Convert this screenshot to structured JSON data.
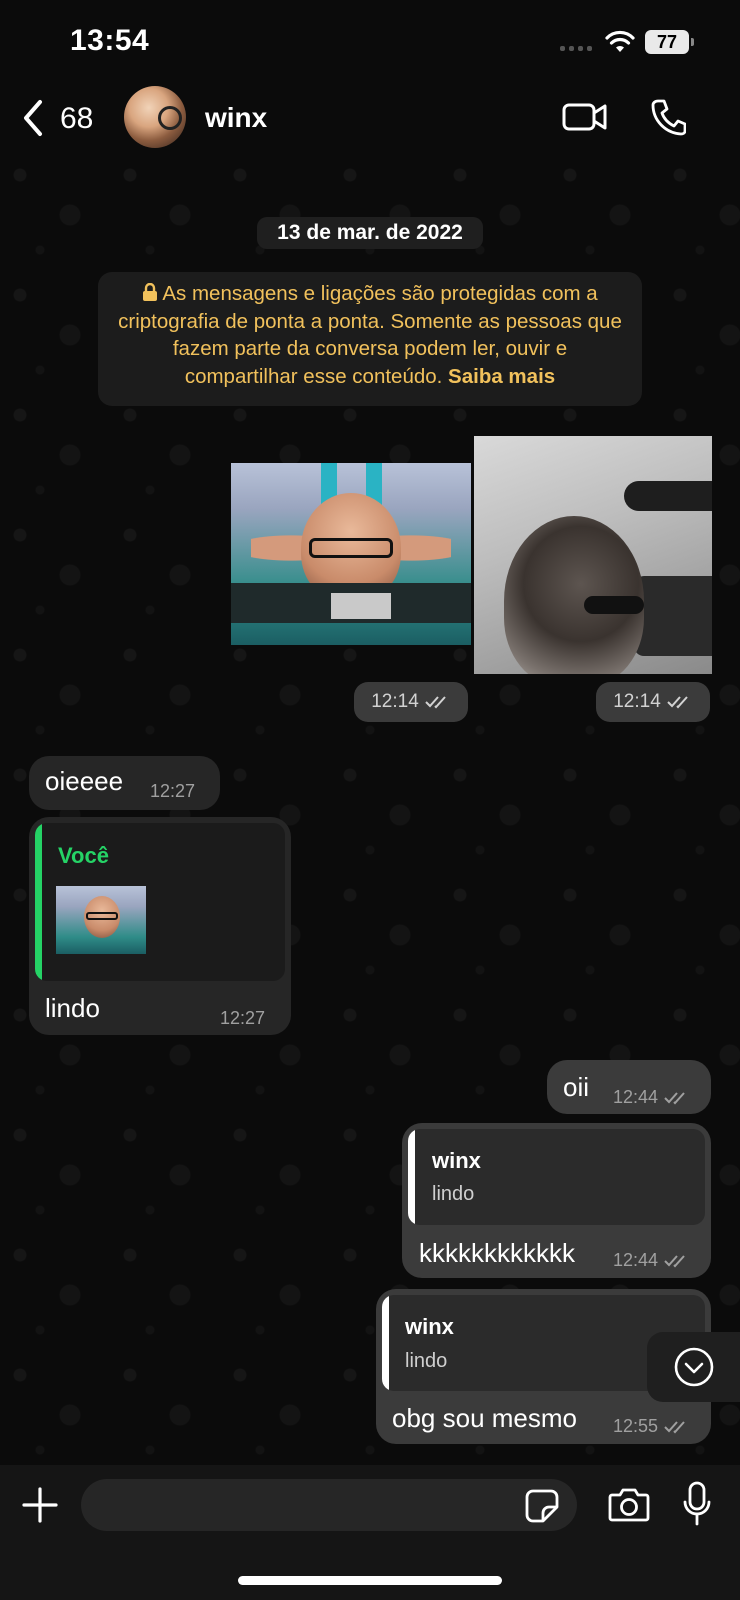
{
  "status_bar": {
    "time": "13:54",
    "battery": "77"
  },
  "header": {
    "back_count": "68",
    "contact_name": "winx"
  },
  "date_chip": "13 de mar. de 2022",
  "encryption_notice": {
    "text": "As mensagens e ligações são protegidas com a criptografia de ponta a ponta. Somente as pessoas que fazem parte da conversa podem ler, ouvir e compartilhar esse conteúdo.",
    "link": "Saiba mais"
  },
  "messages": [
    {
      "type": "image",
      "direction": "out",
      "time": "12:14",
      "status": "read"
    },
    {
      "type": "image",
      "direction": "out",
      "time": "12:14",
      "status": "read"
    },
    {
      "type": "text",
      "direction": "in",
      "text": "oieeee",
      "time": "12:27"
    },
    {
      "type": "reply",
      "direction": "in",
      "reply_sender": "Você",
      "reply_kind": "image",
      "text": "lindo",
      "time": "12:27"
    },
    {
      "type": "text",
      "direction": "out",
      "text": "oii",
      "time": "12:44",
      "status": "read"
    },
    {
      "type": "reply",
      "direction": "out",
      "reply_sender": "winx",
      "reply_text": "lindo",
      "text": "kkkkkkkkkkkk",
      "time": "12:44",
      "status": "read"
    },
    {
      "type": "reply",
      "direction": "out",
      "reply_sender": "winx",
      "reply_text": "lindo",
      "text": "obg sou mesmo",
      "time": "12:55",
      "status": "read"
    }
  ],
  "colors": {
    "notice_text": "#f1c15c",
    "reply_you": "#25d366",
    "incoming_bubble": "#262626",
    "outgoing_bubble": "#3b3b3b"
  },
  "icons": [
    "back-chevron-icon",
    "video-call-icon",
    "phone-icon",
    "lock-icon",
    "double-check-icon",
    "scroll-down-icon",
    "plus-icon",
    "sticker-icon",
    "camera-icon",
    "microphone-icon"
  ]
}
